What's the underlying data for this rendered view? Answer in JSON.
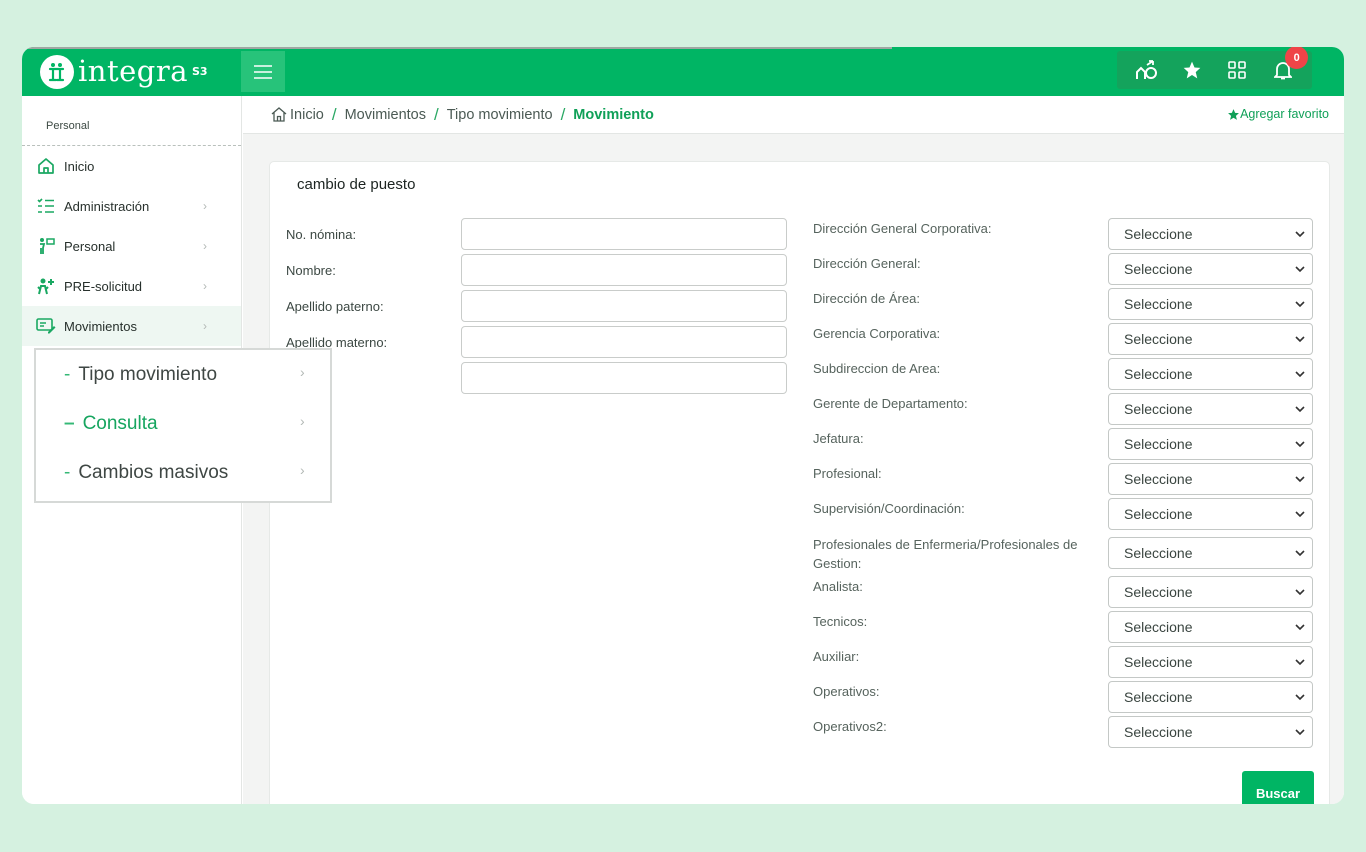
{
  "app": {
    "logo_text": "integra",
    "logo_sub": "S3"
  },
  "topbar": {
    "notifications_count": "0",
    "icons": [
      "org-chart-icon",
      "star-icon",
      "grid-icon",
      "bell-icon"
    ]
  },
  "sidebar": {
    "section": "Personal",
    "items": [
      {
        "label": "Inicio",
        "icon": "home-icon"
      },
      {
        "label": "Administración",
        "icon": "checklist-icon"
      },
      {
        "label": "Personal",
        "icon": "person-board-icon"
      },
      {
        "label": "PRE-solicitud",
        "icon": "person-plus-icon"
      },
      {
        "label": "Movimientos",
        "icon": "card-edit-icon"
      }
    ],
    "submenu": [
      {
        "label": "Tipo movimiento"
      },
      {
        "label": "Consulta"
      },
      {
        "label": "Cambios masivos"
      }
    ]
  },
  "breadcrumb": {
    "items": [
      "Inicio",
      "Movimientos",
      "Tipo movimiento",
      "Movimiento"
    ],
    "favorite_label": "Agregar favorito"
  },
  "form": {
    "title": "cambio de puesto",
    "left_fields": [
      {
        "label": "No. nómina:",
        "value": ""
      },
      {
        "label": "Nombre:",
        "value": ""
      },
      {
        "label": "Apellido paterno:",
        "value": ""
      },
      {
        "label": "Apellido materno:",
        "value": ""
      },
      {
        "label": "",
        "value": ""
      }
    ],
    "right_fields": [
      {
        "label": "Dirección General Corporativa:",
        "value": "Seleccione"
      },
      {
        "label": "Dirección General:",
        "value": "Seleccione"
      },
      {
        "label": "Dirección de Área:",
        "value": "Seleccione"
      },
      {
        "label": "Gerencia Corporativa:",
        "value": "Seleccione"
      },
      {
        "label": "Subdireccion de Area:",
        "value": "Seleccione"
      },
      {
        "label": "Gerente de Departamento:",
        "value": "Seleccione"
      },
      {
        "label": "Jefatura:",
        "value": "Seleccione"
      },
      {
        "label": "Profesional:",
        "value": "Seleccione"
      },
      {
        "label": "Supervisión/Coordinación:",
        "value": "Seleccione"
      },
      {
        "label": "Profesionales de Enfermeria/Profesionales de Gestion:",
        "value": "Seleccione"
      },
      {
        "label": "Analista:",
        "value": "Seleccione"
      },
      {
        "label": "Tecnicos:",
        "value": "Seleccione"
      },
      {
        "label": "Auxiliar:",
        "value": "Seleccione"
      },
      {
        "label": "Operativos:",
        "value": "Seleccione"
      },
      {
        "label": "Operativos2:",
        "value": "Seleccione"
      }
    ],
    "submit_label": "Buscar"
  },
  "colors": {
    "brand": "#00b564",
    "accent_text": "#10a058",
    "background": "#d5f1e0",
    "badge": "#ef4448"
  }
}
